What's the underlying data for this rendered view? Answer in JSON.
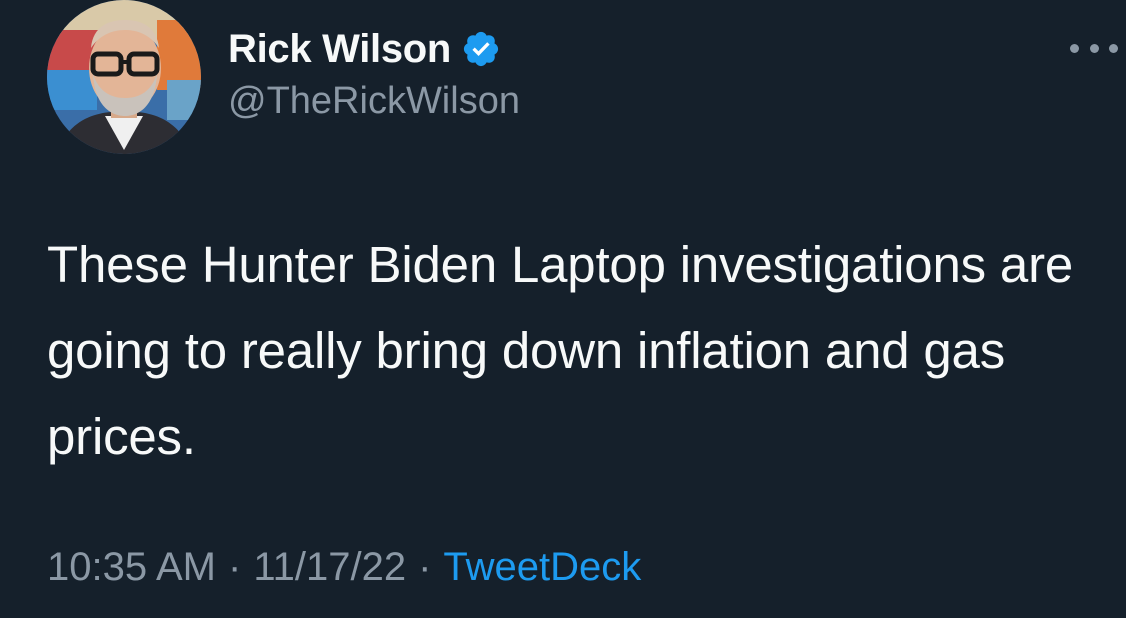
{
  "author": {
    "display_name": "Rick Wilson",
    "handle": "@TheRickWilson",
    "verified": true
  },
  "tweet": {
    "text": "These Hunter Biden Laptop investigations are going to really bring down inflation and gas prices.",
    "time": "10:35 AM",
    "date": "11/17/22",
    "separator": "·",
    "source": "TweetDeck"
  },
  "icons": {
    "verified": "verified-badge-icon",
    "more": "more-options-icon"
  },
  "colors": {
    "background": "#15202b",
    "text_primary": "#f7f9f9",
    "text_secondary": "#8b98a5",
    "accent": "#1d9bf0"
  }
}
